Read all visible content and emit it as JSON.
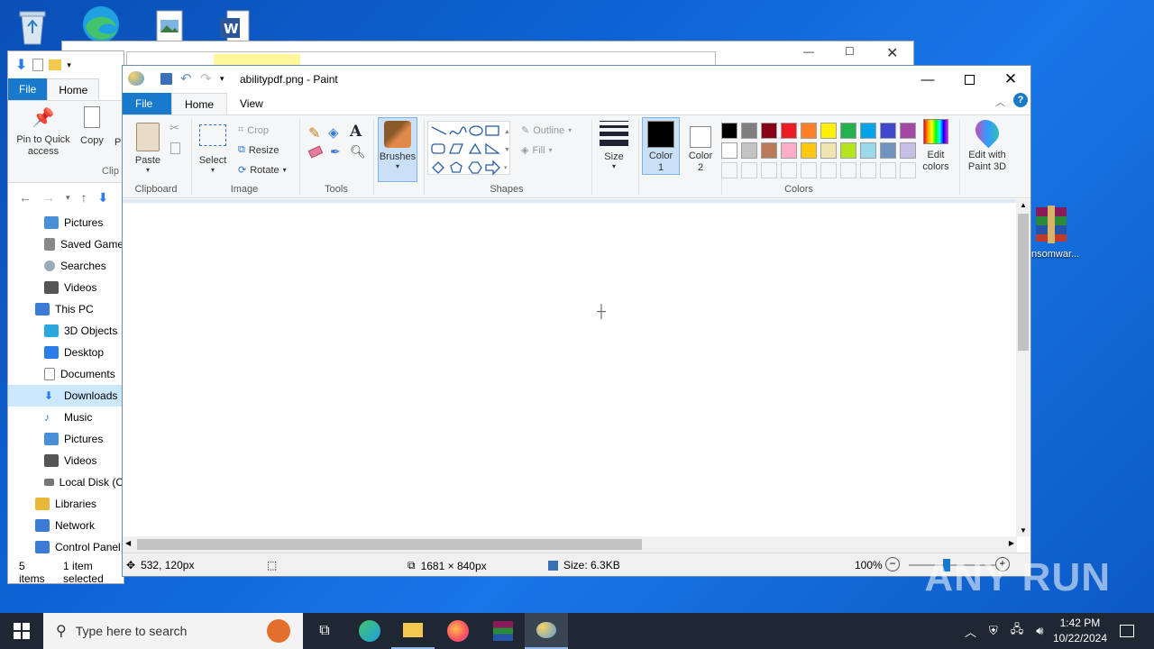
{
  "desktop": {
    "icons": [
      {
        "name": "recycle-bin-icon"
      },
      {
        "name": "edge-icon"
      },
      {
        "name": "image-file-icon"
      },
      {
        "name": "word-file-icon"
      }
    ],
    "ransomware_label": "nsomwar..."
  },
  "explorer": {
    "tabs": {
      "file": "File",
      "home": "Home"
    },
    "ribbon": {
      "pin_label": "Pin to Quick access",
      "copy_label": "Copy",
      "paste_label": "P",
      "group_label": "Clip"
    },
    "tree": [
      {
        "label": "Pictures",
        "color": "#4a90d9"
      },
      {
        "label": "Saved Game",
        "color": "#888888"
      },
      {
        "label": "Searches",
        "color": "#9ab"
      },
      {
        "label": "Videos",
        "color": "#555"
      },
      {
        "label": "This PC",
        "color": "#3a7bd5"
      },
      {
        "label": "3D Objects",
        "color": "#29a8e0"
      },
      {
        "label": "Desktop",
        "color": "#2b7de9"
      },
      {
        "label": "Documents",
        "color": "#8a8a8a"
      },
      {
        "label": "Downloads",
        "color": "#2b7de9"
      },
      {
        "label": "Music",
        "color": "#2b7de9"
      },
      {
        "label": "Pictures",
        "color": "#4a90d9"
      },
      {
        "label": "Videos",
        "color": "#555"
      },
      {
        "label": "Local Disk (C",
        "color": "#777"
      },
      {
        "label": "Libraries",
        "color": "#e8b83a"
      },
      {
        "label": "Network",
        "color": "#3a7bd5"
      },
      {
        "label": "Control Panel",
        "color": "#3a7bd5"
      }
    ],
    "status": {
      "items": "5 items",
      "selected": "1 item selected"
    }
  },
  "paint": {
    "title": "abilitypdf.png - Paint",
    "tabs": {
      "file": "File",
      "home": "Home",
      "view": "View"
    },
    "clipboard": {
      "paste": "Paste",
      "group": "Clipboard"
    },
    "image": {
      "select": "Select",
      "crop": "Crop",
      "resize": "Resize",
      "rotate": "Rotate",
      "group": "Image"
    },
    "tools": {
      "group": "Tools"
    },
    "brushes": {
      "label": "Brushes"
    },
    "shapes": {
      "outline": "Outline",
      "fill": "Fill",
      "group": "Shapes"
    },
    "size": {
      "label": "Size"
    },
    "color1": {
      "label": "Color 1",
      "value": "#000000"
    },
    "color2": {
      "label": "Color 2",
      "value": "#ffffff"
    },
    "colors": {
      "group": "Colors",
      "row1": [
        "#000000",
        "#7f7f7f",
        "#880015",
        "#ed1c24",
        "#ff7f27",
        "#fff200",
        "#22b14c",
        "#00a2e8",
        "#3f48cc",
        "#a349a4"
      ],
      "row2": [
        "#ffffff",
        "#c3c3c3",
        "#b97a57",
        "#ffaec9",
        "#ffc90e",
        "#efe4b0",
        "#b5e61d",
        "#99d9ea",
        "#7092be",
        "#c8bfe7"
      ]
    },
    "edit_colors": "Edit colors",
    "edit_paint3d": "Edit with Paint 3D",
    "status": {
      "cursor": "532, 120px",
      "dimensions": "1681 × 840px",
      "size": "Size: 6.3KB",
      "zoom": "100%"
    }
  },
  "taskbar": {
    "search_placeholder": "Type here to search",
    "time": "1:42 PM",
    "date": "10/22/2024"
  },
  "watermark": "ANY RUN"
}
